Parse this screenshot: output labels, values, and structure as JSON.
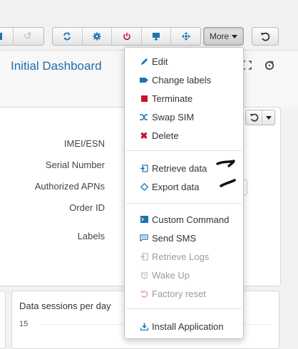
{
  "toolbar": {
    "left_group": [
      "list-icon",
      "undo-icon"
    ],
    "actions": [
      "sync-icon",
      "gear-icon",
      "power-icon",
      "upload-icon",
      "move-icon"
    ],
    "more_label": "More",
    "undo_icon": "undo-icon"
  },
  "header": {
    "title": "Initial Dashboard",
    "icons": [
      "expand-icon",
      "refresh-icon"
    ]
  },
  "details": {
    "labels": [
      "IMEI/ESN",
      "Serial Number",
      "Authorized APNs",
      "Order ID",
      "Labels"
    ]
  },
  "widget": {
    "title": "Data sessions per day",
    "y_tick": "15"
  },
  "menu": {
    "groups": [
      [
        {
          "label": "Edit",
          "icon": "pencil-icon",
          "enabled": true
        },
        {
          "label": "Change labels",
          "icon": "tag-icon",
          "enabled": true
        },
        {
          "label": "Terminate",
          "icon": "stop-icon",
          "enabled": true
        },
        {
          "label": "Swap SIM",
          "icon": "shuffle-icon",
          "enabled": true
        },
        {
          "label": "Delete",
          "icon": "delete-icon",
          "enabled": true
        }
      ],
      [
        {
          "label": "Retrieve data",
          "icon": "retrieve-icon",
          "enabled": true
        },
        {
          "label": "Export data",
          "icon": "export-icon",
          "enabled": true
        }
      ],
      [
        {
          "label": "Custom Command",
          "icon": "terminal-icon",
          "enabled": true
        },
        {
          "label": "Send SMS",
          "icon": "sms-icon",
          "enabled": true
        },
        {
          "label": "Retrieve Logs",
          "icon": "logs-icon",
          "enabled": false
        },
        {
          "label": "Wake Up",
          "icon": "alarm-icon",
          "enabled": false
        },
        {
          "label": "Factory reset",
          "icon": "reset-icon",
          "enabled": false
        }
      ],
      [
        {
          "label": "Install Application",
          "icon": "install-icon",
          "enabled": true
        }
      ]
    ]
  },
  "colors": {
    "accent": "#1c73b0",
    "terminate": "#c8102e",
    "delete": "#c8102e",
    "reset": "#d9534f",
    "disabled_text": "#9a9a9a"
  }
}
